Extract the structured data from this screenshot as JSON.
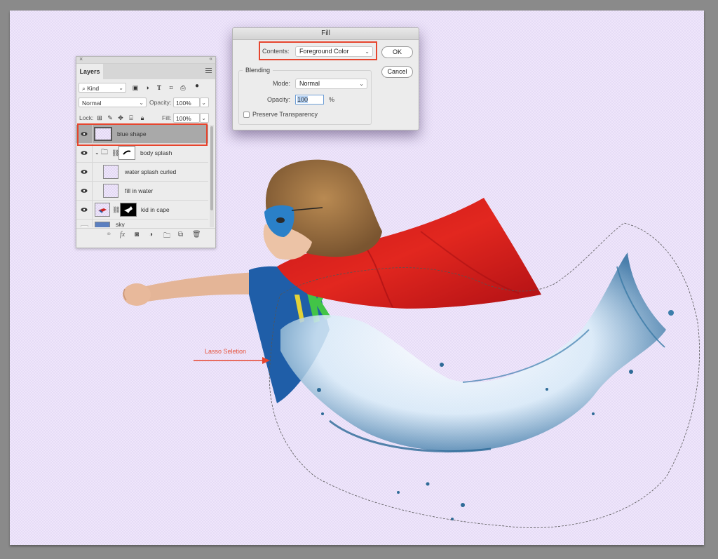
{
  "canvas": {
    "background": "#efe6fb",
    "annotation": {
      "text": "Lasso Seletion",
      "color": "#e6452e"
    }
  },
  "layers_panel": {
    "close_glyph": "×",
    "collapse_glyph": "«",
    "tab_label": "Layers",
    "filter": {
      "value": "Kind",
      "icon": "search-icon"
    },
    "filter_icons": [
      "image-filter-icon",
      "adjustment-filter-icon",
      "type-filter-icon",
      "shape-filter-icon",
      "smart-object-filter-icon",
      "filter-toggle-icon"
    ],
    "blend_mode": "Normal",
    "opacity_label": "Opacity:",
    "opacity_value": "100%",
    "lock_label": "Lock:",
    "lock_icons": [
      "lock-transparent-icon",
      "lock-image-icon",
      "lock-position-icon",
      "lock-artboard-icon",
      "lock-all-icon"
    ],
    "fill_label": "Fill:",
    "fill_value": "100%",
    "layers": [
      {
        "name": "blue shape",
        "visible": true,
        "active": true,
        "kind": "pixel"
      },
      {
        "name": "body splash",
        "visible": true,
        "active": false,
        "kind": "group",
        "expanded": true,
        "has_mask": true
      },
      {
        "name": "water splash curled",
        "visible": true,
        "active": false,
        "kind": "pixel",
        "indented": true
      },
      {
        "name": "fill in water",
        "visible": true,
        "active": false,
        "kind": "pixel",
        "indented": true
      },
      {
        "name": "kid in cape",
        "visible": true,
        "active": false,
        "kind": "pixel",
        "has_mask": true
      },
      {
        "name": "sky",
        "visible": false,
        "active": false,
        "kind": "pixel"
      }
    ],
    "bottom_icons": [
      "link-layers-icon",
      "fx-icon",
      "add-mask-icon",
      "adjustment-layer-icon",
      "new-group-icon",
      "new-layer-icon",
      "trash-icon"
    ]
  },
  "fill_dialog": {
    "title": "Fill",
    "contents_label": "Contents:",
    "contents_value": "Foreground Color",
    "ok_label": "OK",
    "cancel_label": "Cancel",
    "blending_label": "Blending",
    "mode_label": "Mode:",
    "mode_value": "Normal",
    "opacity_label": "Opacity:",
    "opacity_value": "100",
    "opacity_unit": "%",
    "preserve_transparency_label": "Preserve Transparency",
    "preserve_transparency_checked": false
  },
  "highlight_color": "#e6452e"
}
